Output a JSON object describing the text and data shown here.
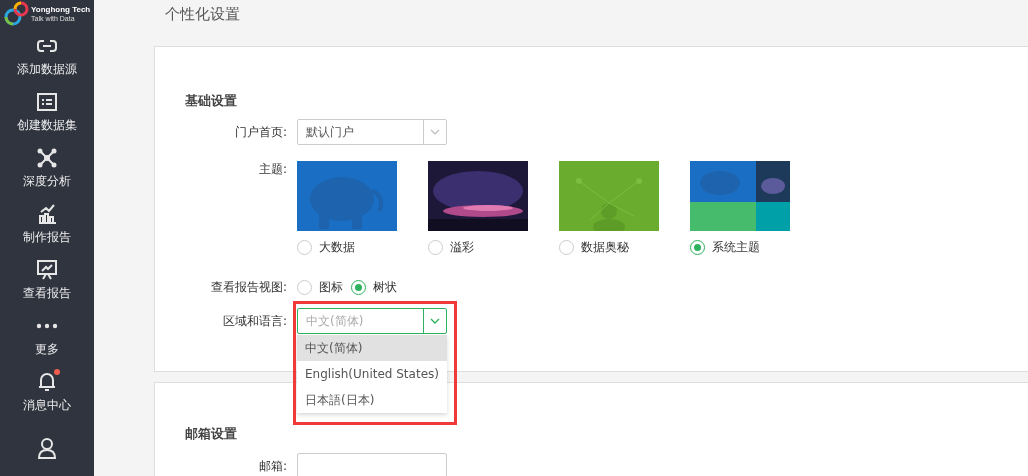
{
  "logo": {
    "name": "Yonghong Tech",
    "slogan": "Talk with Data"
  },
  "sidebar": {
    "items": [
      {
        "label": "添加数据源",
        "badge": false
      },
      {
        "label": "创建数据集",
        "badge": false
      },
      {
        "label": "深度分析",
        "badge": false
      },
      {
        "label": "制作报告",
        "badge": false
      },
      {
        "label": "查看报告",
        "badge": false
      },
      {
        "label": "更多",
        "badge": false
      },
      {
        "label": "消息中心",
        "badge": true
      },
      {
        "badge": false
      }
    ]
  },
  "page": {
    "title": "个性化设置"
  },
  "basic": {
    "title": "基础设置",
    "portal": {
      "label": "门户首页:",
      "value": "默认门户"
    },
    "theme": {
      "label": "主题:",
      "options": [
        {
          "label": "大数据",
          "selected": false,
          "kind": "picture"
        },
        {
          "label": "溢彩",
          "selected": false,
          "kind": "picture"
        },
        {
          "label": "数据奥秘",
          "selected": false,
          "kind": "picture"
        },
        {
          "label": "系统主题",
          "selected": true,
          "kind": "picture"
        }
      ]
    },
    "view": {
      "label": "查看报告视图:",
      "options": [
        {
          "label": "图标",
          "selected": false
        },
        {
          "label": "树状",
          "selected": true
        }
      ]
    },
    "language": {
      "label": "区域和语言:",
      "value": "中文(简体)",
      "open": true,
      "options": [
        {
          "label": "中文(简体)",
          "selected": true
        },
        {
          "label": "English(United States)",
          "selected": false
        },
        {
          "label": "日本語(日本)",
          "selected": false
        }
      ]
    }
  },
  "mail": {
    "title": "邮箱设置",
    "email": {
      "label": "邮箱:"
    }
  }
}
